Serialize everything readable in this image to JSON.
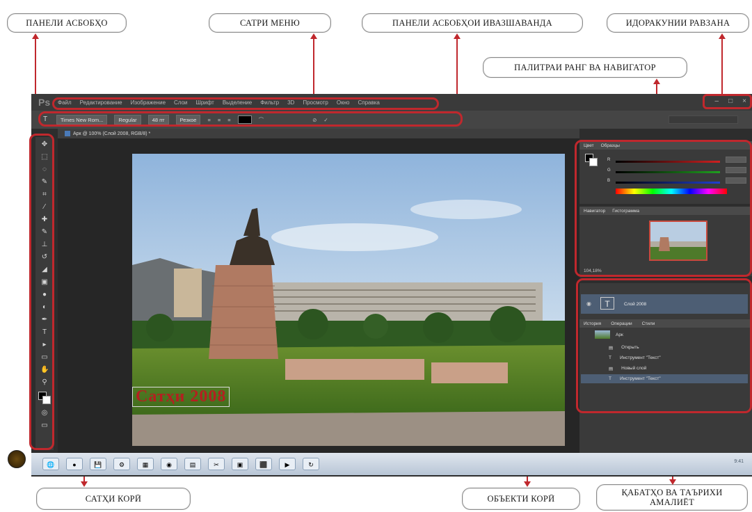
{
  "callouts": {
    "tools_panel": "ПАНЕЛИ АСБОБҲО",
    "menu_bar": "САТРИ МЕНЮ",
    "options_bar": "ПАНЕЛИ АСБОБҲОИ ИВАЗШАВАНДА",
    "window_controls": "ИДОРАКУНИИ РАВЗАНА",
    "color_navigator": "ПАЛИТРАИ РАНГ ВА НАВИГАТОР",
    "workspace": "САТҲИ КОРӢ",
    "work_object": "ОБЪЕКТИ КОРӢ",
    "layers_history": "ҚАБАТҲО ВА ТАЪРИХИ АМАЛИЁТ"
  },
  "app": {
    "logo": "Ps",
    "menu": [
      "Файл",
      "Редактирование",
      "Изображение",
      "Слои",
      "Шрифт",
      "Выделение",
      "Фильтр",
      "3D",
      "Просмотр",
      "Окно",
      "Справка"
    ],
    "window_controls": [
      "–",
      "□",
      "×"
    ],
    "options": {
      "font_family": "Times New Rom...",
      "font_style": "Regular",
      "font_size": "48 пт",
      "aa": "Резкое"
    },
    "document_tab": "Арк @ 100% (Слой 2008, RGB/8) *",
    "image_caption": "Сатҳи 2008"
  },
  "panels": {
    "color_tabs": [
      "Цвет",
      "Образцы"
    ],
    "color_channels": [
      {
        "label": "R",
        "value": "0",
        "color": "#d02020"
      },
      {
        "label": "G",
        "value": "0",
        "color": "#20a020"
      },
      {
        "label": "B",
        "value": "0",
        "color": "#2040d0"
      }
    ],
    "nav_tabs": [
      "Навигатор",
      "Гистограмма"
    ],
    "zoom": "104,18%",
    "layer_name": "Слой 2008",
    "history_tabs": [
      "История",
      "Операции",
      "Стили"
    ],
    "history_snapshot": "Арк",
    "history_items": [
      {
        "icon": "▤",
        "label": "Открыть"
      },
      {
        "icon": "T",
        "label": "Инструмент \"Текст\""
      },
      {
        "icon": "▤",
        "label": "Новый слой"
      },
      {
        "icon": "T",
        "label": "Инструмент \"Текст\""
      }
    ]
  },
  "taskbar": {
    "icons": [
      "🌐",
      "●",
      "💾",
      "⚙",
      "▦",
      "◉",
      "▤",
      "✂",
      "▣",
      "⬛",
      "▶",
      "↻"
    ],
    "clock": "9:41"
  }
}
